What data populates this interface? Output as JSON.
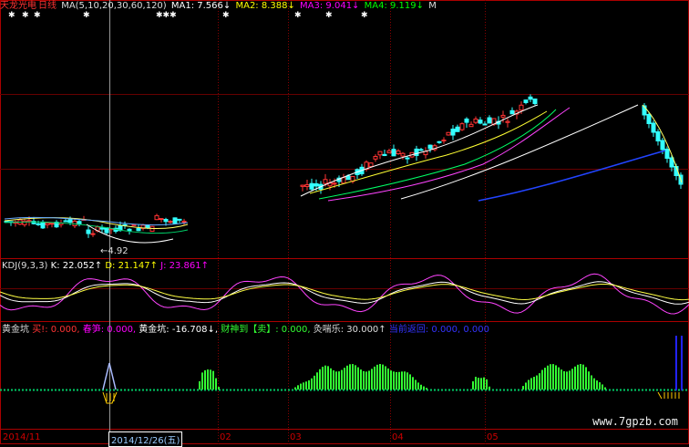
{
  "header": {
    "stock_name": "天龙光电",
    "period": "日线",
    "ma_def": "MA(5,10,20,30,60,120)",
    "ma1": "MA1: 7.566↓",
    "ma2": "MA2: 8.388↓",
    "ma3": "MA3: 9.041↓",
    "ma4": "MA4: 9.119↓",
    "trail": "M",
    "colors": {
      "name": "#ff3333",
      "period": "#ff3333",
      "ma1": "#ffffff",
      "ma2": "#ffff00",
      "ma3": "#ff00ff",
      "ma4": "#00ff00"
    }
  },
  "price_low_label": "4.92",
  "kdj": {
    "def": "KDJ(9,3,3)",
    "k": "K: 22.052↑",
    "d": "D: 21.147↑",
    "j": "J: 23.861↑"
  },
  "indicator": {
    "name": "黄金坑",
    "buy": "买!: 0.000,",
    "spring": "春笋: 0.000,",
    "gold": "黄金坑: -16.708↓,",
    "fortune": "财神到【卖】: 0.000,",
    "sentiment": "灸喘乐: 30.000↑",
    "extra": "当前返回: 0.000, 0.000"
  },
  "xaxis": {
    "start": "2014/11",
    "cursor_date": "2014/12/26(五)",
    "m02": "02",
    "m03": "03",
    "m04": "04",
    "m05": "05"
  },
  "watermark": "www.7gpzb.com"
}
